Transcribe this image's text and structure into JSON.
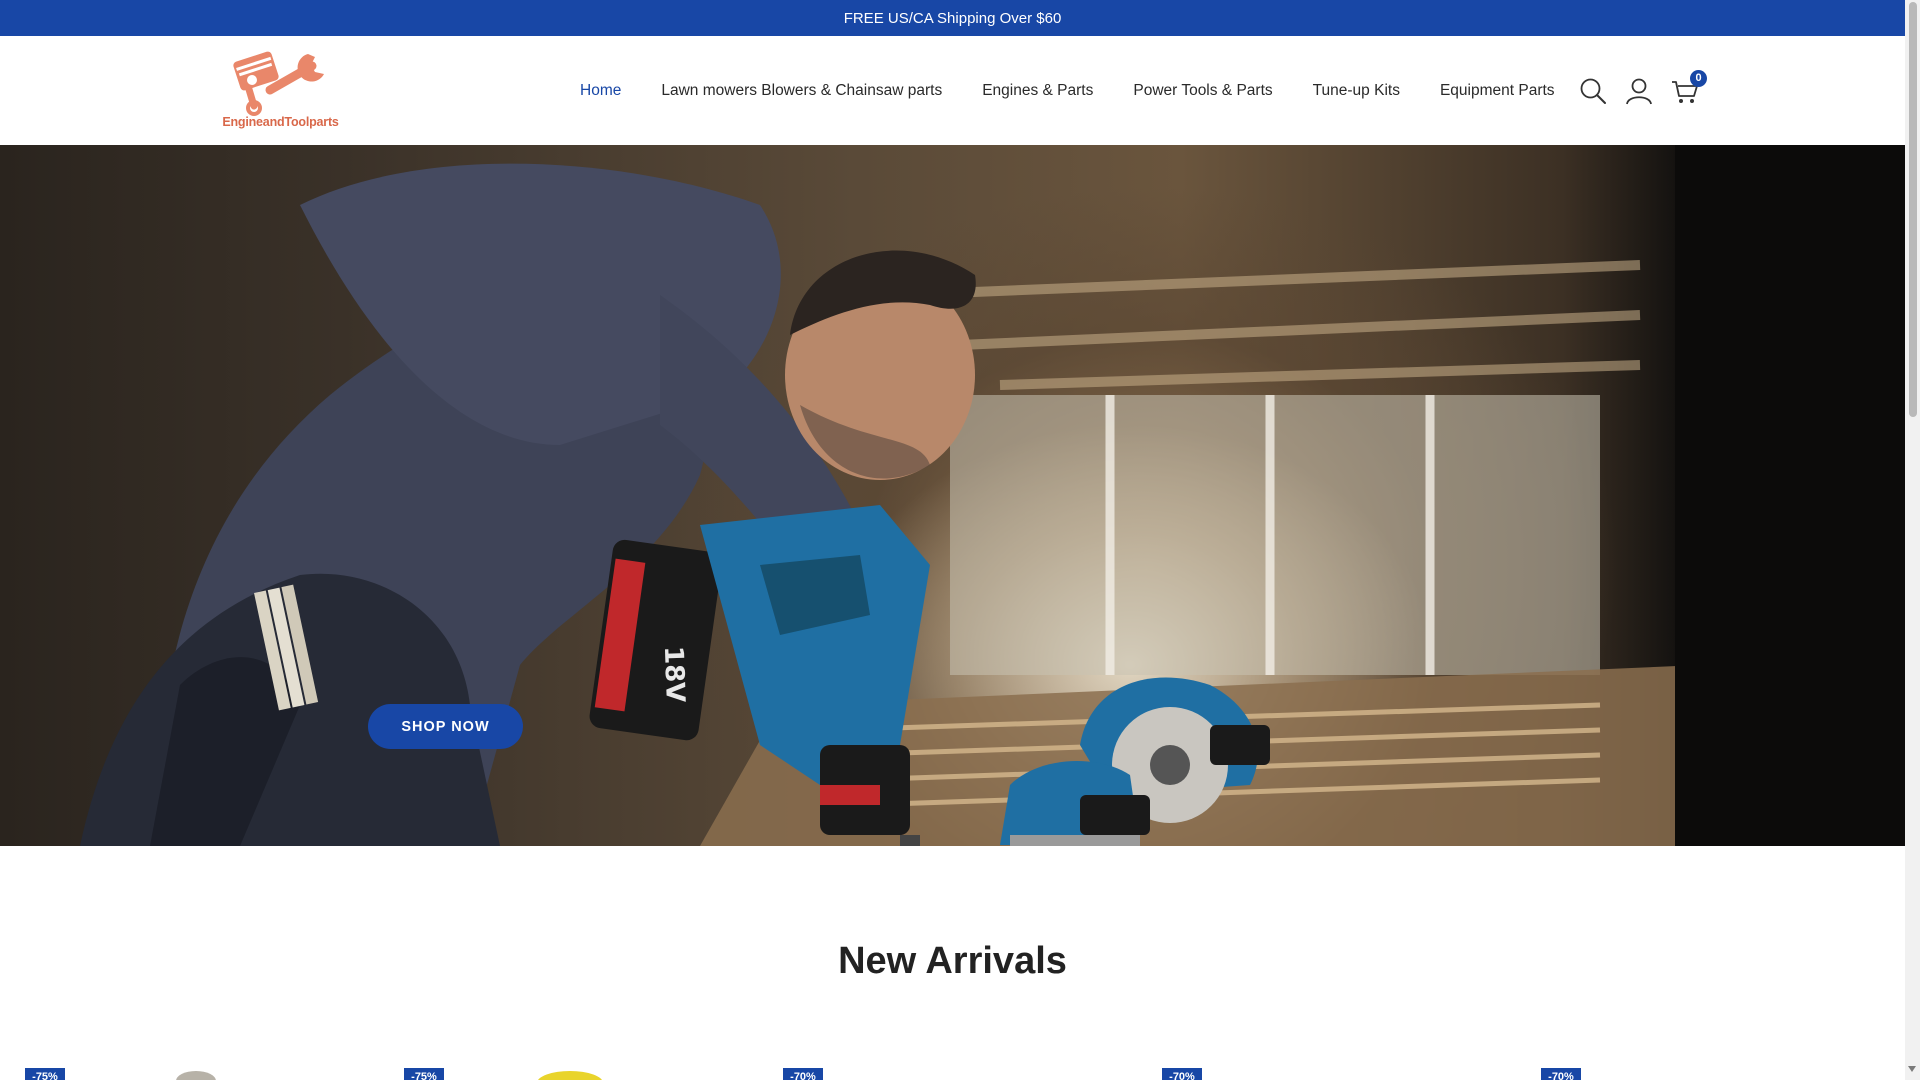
{
  "announcement": {
    "text": "FREE US/CA Shipping Over $60"
  },
  "brand": {
    "logo_text": "EngineandToolparts",
    "accent": "#1847a6",
    "logo_color": "#e9876a"
  },
  "nav": {
    "items": [
      {
        "label": "Home",
        "active": true
      },
      {
        "label": "Lawn mowers Blowers & Chainsaw parts",
        "active": false
      },
      {
        "label": "Engines & Parts",
        "active": false
      },
      {
        "label": "Power Tools & Parts",
        "active": false
      },
      {
        "label": "Tune-up Kits",
        "active": false
      },
      {
        "label": "Equipment Parts",
        "active": false
      }
    ]
  },
  "header_icons": {
    "search": "search-icon",
    "account": "user-icon",
    "cart": "cart-icon",
    "cart_count": "0"
  },
  "hero": {
    "cta_label": "SHOP NOW",
    "battery_label": "18V"
  },
  "new_arrivals": {
    "title": "New Arrivals",
    "badges": [
      "-75%",
      "-75%",
      "-70%",
      "-70%",
      "-70%"
    ]
  }
}
